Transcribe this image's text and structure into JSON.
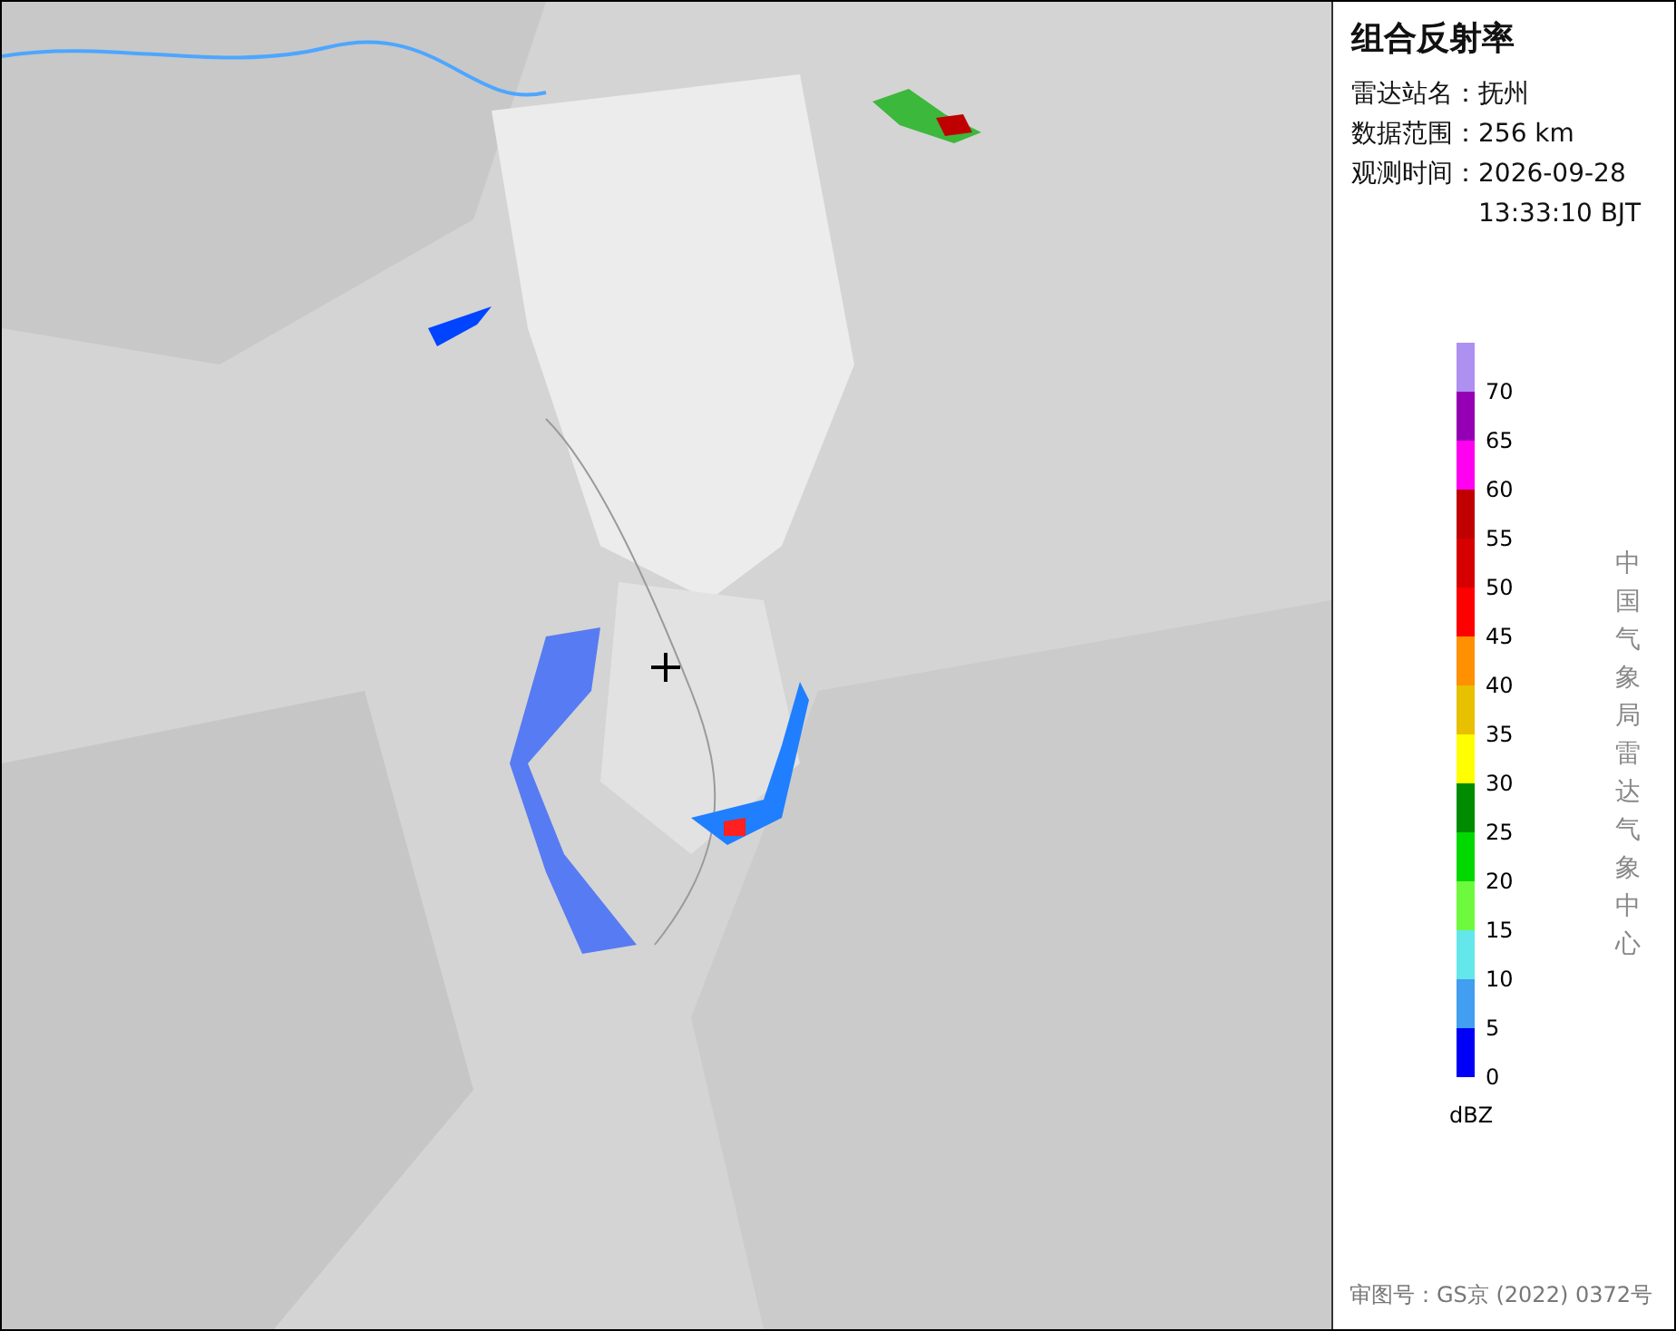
{
  "panel": {
    "title": "组合反射率",
    "info": [
      {
        "label": "雷达站名：",
        "value": "抚州"
      },
      {
        "label": "数据范围：",
        "value": "256 km"
      },
      {
        "label": "观测时间：",
        "value": "2026-09-28 13:33:10 BJT"
      }
    ],
    "legend": {
      "items": [
        {
          "label": "70",
          "color": "#ad90f0"
        },
        {
          "label": "65",
          "color": "#9600b4"
        },
        {
          "label": "60",
          "color": "#ff00f0"
        },
        {
          "label": "55",
          "color": "#c00000"
        },
        {
          "label": "50",
          "color": "#d60000"
        },
        {
          "label": "45",
          "color": "#ff0000"
        },
        {
          "label": "40",
          "color": "#ff9000"
        },
        {
          "label": "35",
          "color": "#e7c000"
        },
        {
          "label": "30",
          "color": "#ffff00"
        },
        {
          "label": "25",
          "color": "#008c00"
        },
        {
          "label": "20",
          "color": "#00d800"
        },
        {
          "label": "15",
          "color": "#6dfa3d"
        },
        {
          "label": "10",
          "color": "#64e7eb"
        },
        {
          "label": "5",
          "color": "#419ef0"
        },
        {
          "label": "0",
          "color": "#0000f6"
        }
      ],
      "unit": "dBZ"
    },
    "credit": "中国气象局雷达气象中心",
    "footer": "审图号：GS京 (2022) 0372号"
  }
}
